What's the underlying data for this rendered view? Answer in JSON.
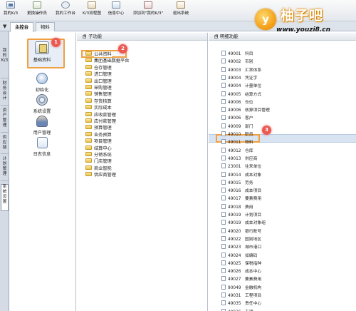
{
  "toolbar": {
    "items": [
      {
        "label": "我的K/3",
        "icon": "home-icon"
      },
      {
        "label": "更换操作员",
        "icon": "user-switch-icon"
      },
      {
        "label": "我的工作台",
        "icon": "workbench-icon"
      },
      {
        "label": "K/3流程图",
        "icon": "flowchart-icon"
      },
      {
        "label": "信息中心",
        "icon": "info-center-icon"
      },
      {
        "label": "添加到\"我的K/3\"",
        "icon": "add-favorite-icon"
      },
      {
        "label": "退出系统",
        "icon": "exit-icon"
      }
    ]
  },
  "watermark": {
    "logo_char": "y",
    "title": "柚子吧",
    "url": "www.youzi8.cn"
  },
  "tabs": [
    {
      "label": "主控台",
      "active": true
    },
    {
      "label": "物料",
      "active": false
    }
  ],
  "left_nav": [
    {
      "label": "我的K/3",
      "active": false
    },
    {
      "label": "财务会计",
      "active": false
    },
    {
      "label": "资产管理",
      "active": false
    },
    {
      "label": "供应链",
      "active": false
    },
    {
      "label": "计划管理",
      "active": false
    },
    {
      "label": "系统设置",
      "active": true
    }
  ],
  "modules": [
    {
      "label": "基础资料",
      "icon": "basic-data-icon",
      "selected": true
    },
    {
      "label": "初始化",
      "icon": "init-icon",
      "selected": false
    },
    {
      "label": "系统设置",
      "icon": "system-settings-icon",
      "selected": false
    },
    {
      "label": "用户管理",
      "icon": "user-management-icon",
      "selected": false
    },
    {
      "label": "日志信息",
      "icon": "log-icon",
      "selected": false
    }
  ],
  "subfunction": {
    "header": "子功能",
    "expander": "日",
    "items": [
      "公共资料",
      "集团基础数据平台",
      "仓存管理",
      "进口管理",
      "出口管理",
      "采购管理",
      "销售管理",
      "存货核算",
      "实际成本",
      "应收款管理",
      "应付款管理",
      "预算管理",
      "业务预算",
      "项目管理",
      "结算中心",
      "分销系统",
      "门店管理",
      "商业智能",
      "供应商管理"
    ],
    "selected_index": 0
  },
  "detail": {
    "header": "明细功能",
    "expander": "日",
    "items": [
      {
        "code": "49001",
        "name": "科目"
      },
      {
        "code": "49002",
        "name": "币别"
      },
      {
        "code": "49003",
        "name": "汇率体系"
      },
      {
        "code": "49004",
        "name": "凭证字"
      },
      {
        "code": "49004",
        "name": "计量单位"
      },
      {
        "code": "49005",
        "name": "结算方式"
      },
      {
        "code": "49006",
        "name": "仓位"
      },
      {
        "code": "49006",
        "name": "核算项目管理"
      },
      {
        "code": "49006",
        "name": "客户"
      },
      {
        "code": "49009",
        "name": "部门"
      },
      {
        "code": "49010",
        "name": "职员"
      },
      {
        "code": "49011",
        "name": "物料"
      },
      {
        "code": "49012",
        "name": "仓库"
      },
      {
        "code": "49013",
        "name": "供应商"
      },
      {
        "code": "23001",
        "name": "往来单位"
      },
      {
        "code": "49014",
        "name": "成本对象"
      },
      {
        "code": "49015",
        "name": "劳务"
      },
      {
        "code": "49016",
        "name": "成本项目"
      },
      {
        "code": "49017",
        "name": "要素费用"
      },
      {
        "code": "49018",
        "name": "费用"
      },
      {
        "code": "49019",
        "name": "计划项目"
      },
      {
        "code": "49019",
        "name": "成本对象组"
      },
      {
        "code": "49020",
        "name": "银行账号"
      },
      {
        "code": "49022",
        "name": "国别地区"
      },
      {
        "code": "49023",
        "name": "城市港口"
      },
      {
        "code": "49024",
        "name": "如编码"
      },
      {
        "code": "49025",
        "name": "保税指种"
      },
      {
        "code": "49026",
        "name": "成本中心"
      },
      {
        "code": "49027",
        "name": "要素费用"
      },
      {
        "code": "90049",
        "name": "金融机构"
      },
      {
        "code": "49031",
        "name": "工程项目"
      },
      {
        "code": "49035",
        "name": "责任中心"
      },
      {
        "code": "49036",
        "name": "专项"
      },
      {
        "code": "49037",
        "name": "分支机构"
      }
    ],
    "selected_index": 11
  },
  "badges": [
    "1",
    "2",
    "3"
  ],
  "colors": {
    "highlight_border": "#f0a040",
    "badge": "#ea5a52",
    "toolbar_bg": "#e4e8ee",
    "selection_bg": "#d8e4f2"
  }
}
